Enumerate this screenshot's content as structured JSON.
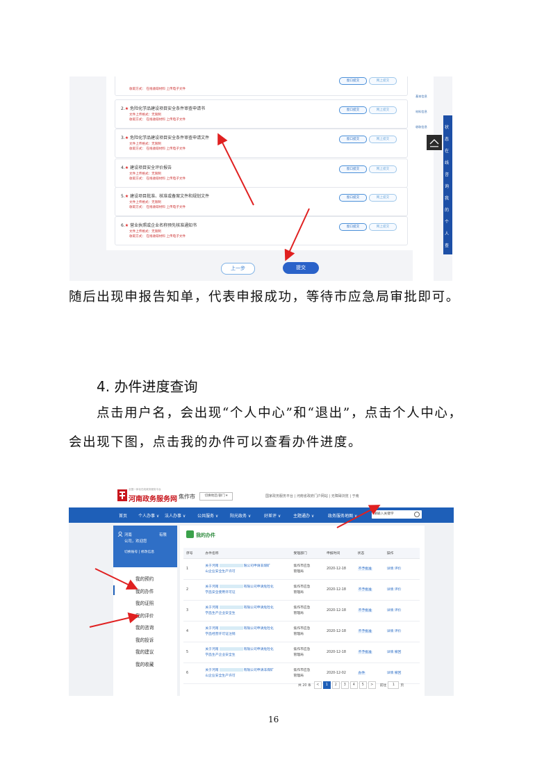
{
  "shot1": {
    "top_sub": "收取方式：  在线收取材料 上传电子文件",
    "items": [
      {
        "num": "2.",
        "title": "危险化学品建设项目安全条件审查申请书",
        "sub1": "文件上传格式：无限制",
        "sub2": "收取方式：  在线收取材料 上传电子文件"
      },
      {
        "num": "3.",
        "title": "危险化学品建设项目安全条件审查申请文件",
        "sub1": "文件上传格式：无限制",
        "sub2": "收取方式：  在线收取材料 上传电子文件"
      },
      {
        "num": "4.",
        "title": "建设项目安全评价报告",
        "sub1": "文件上传格式：无限制",
        "sub2": "收取方式：  在线收取材料 上传电子文件"
      },
      {
        "num": "5.",
        "title": "建设项目批准、核准或备案文件和规划文件",
        "sub1": "文件上传格式：无限制",
        "sub2": "收取方式：  在线收取材料 上传电子文件"
      },
      {
        "num": "6.",
        "title": "营业执照或企业名称预先核准通知书",
        "sub1": "文件上传格式：无限制",
        "sub2": "收取方式：  在线收取材料 上传电子文件"
      }
    ],
    "btn_window": "窗口提交",
    "btn_net": "网上提交",
    "btn_prev": "上一步",
    "btn_submit": "提交",
    "side_links": [
      "基本信息",
      "材料信息",
      "收取信息"
    ],
    "strip_chars": [
      "状",
      "态",
      "在",
      "线",
      "咨",
      "询",
      "我",
      "的",
      "个",
      "人",
      "查"
    ]
  },
  "para1": "随后出现申报告知单，代表申报成功，等待市应急局审批即可。",
  "heading": "4. 办件进度查询",
  "para2_line1": "点击用户名，会出现“个人中心”和“退出”，点击个人中心，",
  "para2_line2": "会出现下图，点击我的办件可以查看办件进度。",
  "shot2": {
    "slogan": "全国一体化在线政务服务平台",
    "site_name": "河南政务服务网",
    "city": "焦作市",
    "switch_label": "切换地区/部门 ▾",
    "top_links": "国家政务服务平台  |  河南省政府门户网站  |  无障碍浏览  |  于南",
    "nav": [
      "首页",
      "个人办事 ∨",
      "法人办事 ∨",
      "公共服务 ∨",
      "阳光政务 ∨",
      "好差评 ∨",
      "主题通办 ∨",
      "政务服务地图 ∨"
    ],
    "search_placeholder": "请输入关键字",
    "user_line1": "河南",
    "user_line1b": "有限",
    "user_line2": "公司，欢迎您",
    "user_links": "切换账号  |  修改信息",
    "menu": [
      "我的预约",
      "我的办件",
      "我的证照",
      "我的评价",
      "我的咨询",
      "我的投诉",
      "我的建议",
      "我的收藏"
    ],
    "main_title": "我的办件",
    "columns": [
      "序号",
      "办件名称",
      "受理部门",
      "申报时间",
      "状态",
      "操作"
    ],
    "rows": [
      {
        "no": "1",
        "name1": "关于河南",
        "name1b": "限公司申请非煤矿",
        "name2": "山企业安全生产许可",
        "dept1": "焦作市应急",
        "dept2": "管理局",
        "date": "2020-12-18",
        "status": "不予批准",
        "ops": "详情  评价"
      },
      {
        "no": "2",
        "name1": "关于河南",
        "name1b": "有限公司申请危险化",
        "name2": "学品安全使用许可证",
        "dept1": "焦作市应急",
        "dept2": "管理局",
        "date": "2020-12-18",
        "status": "不予批准",
        "ops": "详情  评价"
      },
      {
        "no": "3",
        "name1": "关于河南",
        "name1b": "有限公司申请危险化",
        "name2": "学品生产企业安全生",
        "dept1": "焦作市应急",
        "dept2": "管理局",
        "date": "2020-12-18",
        "status": "不予批准",
        "ops": "详情  评价"
      },
      {
        "no": "4",
        "name1": "关于河南",
        "name1b": "有限公司申请危险化",
        "name2": "学品经营许可证注销",
        "dept1": "焦作市应急",
        "dept2": "管理局",
        "date": "2020-12-18",
        "status": "不予批准",
        "ops": "详情  评价"
      },
      {
        "no": "5",
        "name1": "关于河南",
        "name1b": "有限公司申请危险化",
        "name2": "学品生产企业安全生",
        "dept1": "焦作市应急",
        "dept2": "管理局",
        "date": "2020-12-18",
        "status": "不予批准",
        "ops": "详情  撤回"
      },
      {
        "no": "6",
        "name1": "关于河南",
        "name1b": "有限公司申请非煤矿",
        "name2": "山企业安全生产许可",
        "dept1": "焦作市应急",
        "dept2": "管理局",
        "date": "2020-12-02",
        "status": "办件",
        "ops": "详情  撤回"
      }
    ],
    "pager_total": "共 20 条",
    "pages": [
      "<",
      "1",
      "2",
      "3",
      "4",
      "5",
      ">"
    ],
    "goto_label": "前往",
    "goto_value": "1",
    "goto_unit": "页"
  },
  "page_number": "16",
  "colors": {
    "arrow": "#e02020",
    "nav_blue": "#1e5fb8",
    "brand_red": "#c8161d"
  }
}
